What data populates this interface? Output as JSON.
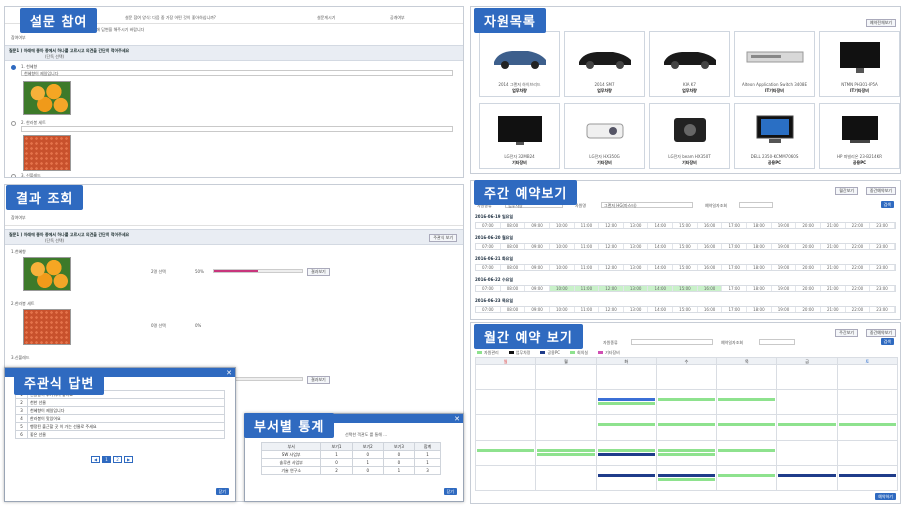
{
  "colors": {
    "accent": "#2f6ac0",
    "progress": "#c8357c",
    "evt_blue": "#3b6fd6",
    "evt_green": "#8ee28e",
    "evt_navy": "#1f3c8a"
  },
  "survey": {
    "badge": "설문 참여",
    "title_field": "설문 참여 양식: 다음 중 가장 어떤 것이 좋아하십니까?",
    "date_label": "설문게시기",
    "date_value": "공개여부",
    "row2_label": "참여여부",
    "row2_value": "설문에 답변을 해주시기 바랍니다",
    "question": "질문1 ) 아래에 좋아 종에서 하나를 고르시고 의견을 간단히 적어주세요",
    "question_sub": "(단독 선택)",
    "options": [
      {
        "label": "1. 천혜향",
        "comment": "천혜향이 제일입니다"
      },
      {
        "label": "2. 한라봉 세트",
        "comment": ""
      },
      {
        "label": "3. 신볼레드",
        "comment": ""
      }
    ]
  },
  "result": {
    "badge": "결과 조회",
    "row_label": "참여여부",
    "question": "질문1 ) 아래에 좋아 종에서 하나를 고르시고 의견을 간단히 적어주세요",
    "question_sub": "(단독 선택)",
    "print_btn": "주관식 보기",
    "items": [
      {
        "label": "1.천혜향",
        "count": "2명 선택",
        "percent": 50,
        "percent_text": "50%",
        "btn": "결과보기"
      },
      {
        "label": "2.한라봉 세트",
        "count": "0명 선택",
        "percent": 0,
        "percent_text": "0%",
        "btn": ""
      },
      {
        "label": "3.신볼레드",
        "count": "",
        "percent": 0,
        "percent_text": "",
        "btn": "결과보기"
      }
    ]
  },
  "subjective": {
    "badge": "주관식 답변",
    "rows": [
      "1",
      "2",
      "3",
      "4",
      "5",
      "6"
    ],
    "answers": [
      "선물용이 무거워서 좋아요",
      "천한 선물",
      "천혜향이 제일입니다",
      "한라봉이 맛있어요",
      "행정된 출근할 곳 이 가는 선물로 주세요",
      "좋은 선물"
    ],
    "pager": [
      "◀",
      "1",
      "2",
      "▶"
    ],
    "close_btn": "닫기"
  },
  "dept": {
    "badge": "부서별 통계",
    "modal_title": "선택한 객관도 를 통해 ...",
    "headers": [
      "부서",
      "보기1",
      "보기2",
      "보기3",
      "합계"
    ],
    "rows": [
      [
        "SW 사업부",
        "1",
        "0",
        "0",
        "1"
      ],
      [
        "솔루션 사업부",
        "0",
        "1",
        "0",
        "1"
      ],
      [
        "기술 연구소",
        "2",
        "0",
        "1",
        "3"
      ]
    ],
    "close_btn": "닫기"
  },
  "resources": {
    "badge": "자원목록",
    "top_btn": "예약전체보기",
    "items": [
      {
        "name": "2014 그랜저 하이브리드",
        "cat": "업무차량",
        "kind": "car-blue"
      },
      {
        "name": "2014 SM7",
        "cat": "업무차량",
        "kind": "car-black"
      },
      {
        "name": "KIA K7",
        "cat": "업무차량",
        "kind": "car-black"
      },
      {
        "name": "Alteon Application Switch 3408E",
        "cat": "IT기타장비",
        "kind": "switch"
      },
      {
        "name": "NTMN PH301-IP5A",
        "cat": "IT기타장비",
        "kind": "monitor"
      },
      {
        "name": "LG전자 32MB24",
        "cat": "기타장비",
        "kind": "tv"
      },
      {
        "name": "LG전자 HX350G",
        "cat": "기타장비",
        "kind": "projector"
      },
      {
        "name": "LG전자 beam HX350T",
        "cat": "기타장비",
        "kind": "projector2"
      },
      {
        "name": "DELL 2350-KCMM7060S",
        "cat": "공용PC",
        "kind": "pc"
      },
      {
        "name": "HP 파빌리온 23-B214KR",
        "cat": "공용PC",
        "kind": "pc2"
      }
    ]
  },
  "weekly": {
    "badge": "주간 예약보기",
    "top_btns": [
      "월간보기",
      "중간예약보기"
    ],
    "filter_labels": [
      "자원종류",
      "자원명",
      "예약일자조회"
    ],
    "filter_values": [
      "업무차량",
      "그랜저 HG(마스터)"
    ],
    "search_btn": "검색",
    "days": [
      "2016-06-19 일요일",
      "2016-06-20 월요일",
      "2016-06-21 화요일",
      "2016-06-22 수요일",
      "2016-06-23 목요일"
    ],
    "times": [
      "07:00",
      "08:00",
      "09:00",
      "10:00",
      "11:00",
      "12:00",
      "13:00",
      "14:00",
      "15:00",
      "16:00",
      "17:00",
      "18:00",
      "19:00",
      "20:00",
      "21:00",
      "22:00",
      "23:00"
    ]
  },
  "monthly": {
    "badge": "월간 예약 보기",
    "top_btns": [
      "주간보기",
      "중간예약보기"
    ],
    "filter_labels": [
      "자원종류",
      "예약일자조회"
    ],
    "search_btn": "검색",
    "legend": [
      {
        "label": "자원관리",
        "color": "#8ee28e"
      },
      {
        "label": "업무차량",
        "color": "#111111"
      },
      {
        "label": "공용PC",
        "color": "#1f3c8a"
      },
      {
        "label": "회의실",
        "color": "#8ee28e"
      },
      {
        "label": "기타장비",
        "color": "#d04fb3"
      }
    ],
    "weekdays": [
      "일",
      "월",
      "화",
      "수",
      "목",
      "금",
      "토"
    ],
    "bottom_btn": "예약하기"
  }
}
